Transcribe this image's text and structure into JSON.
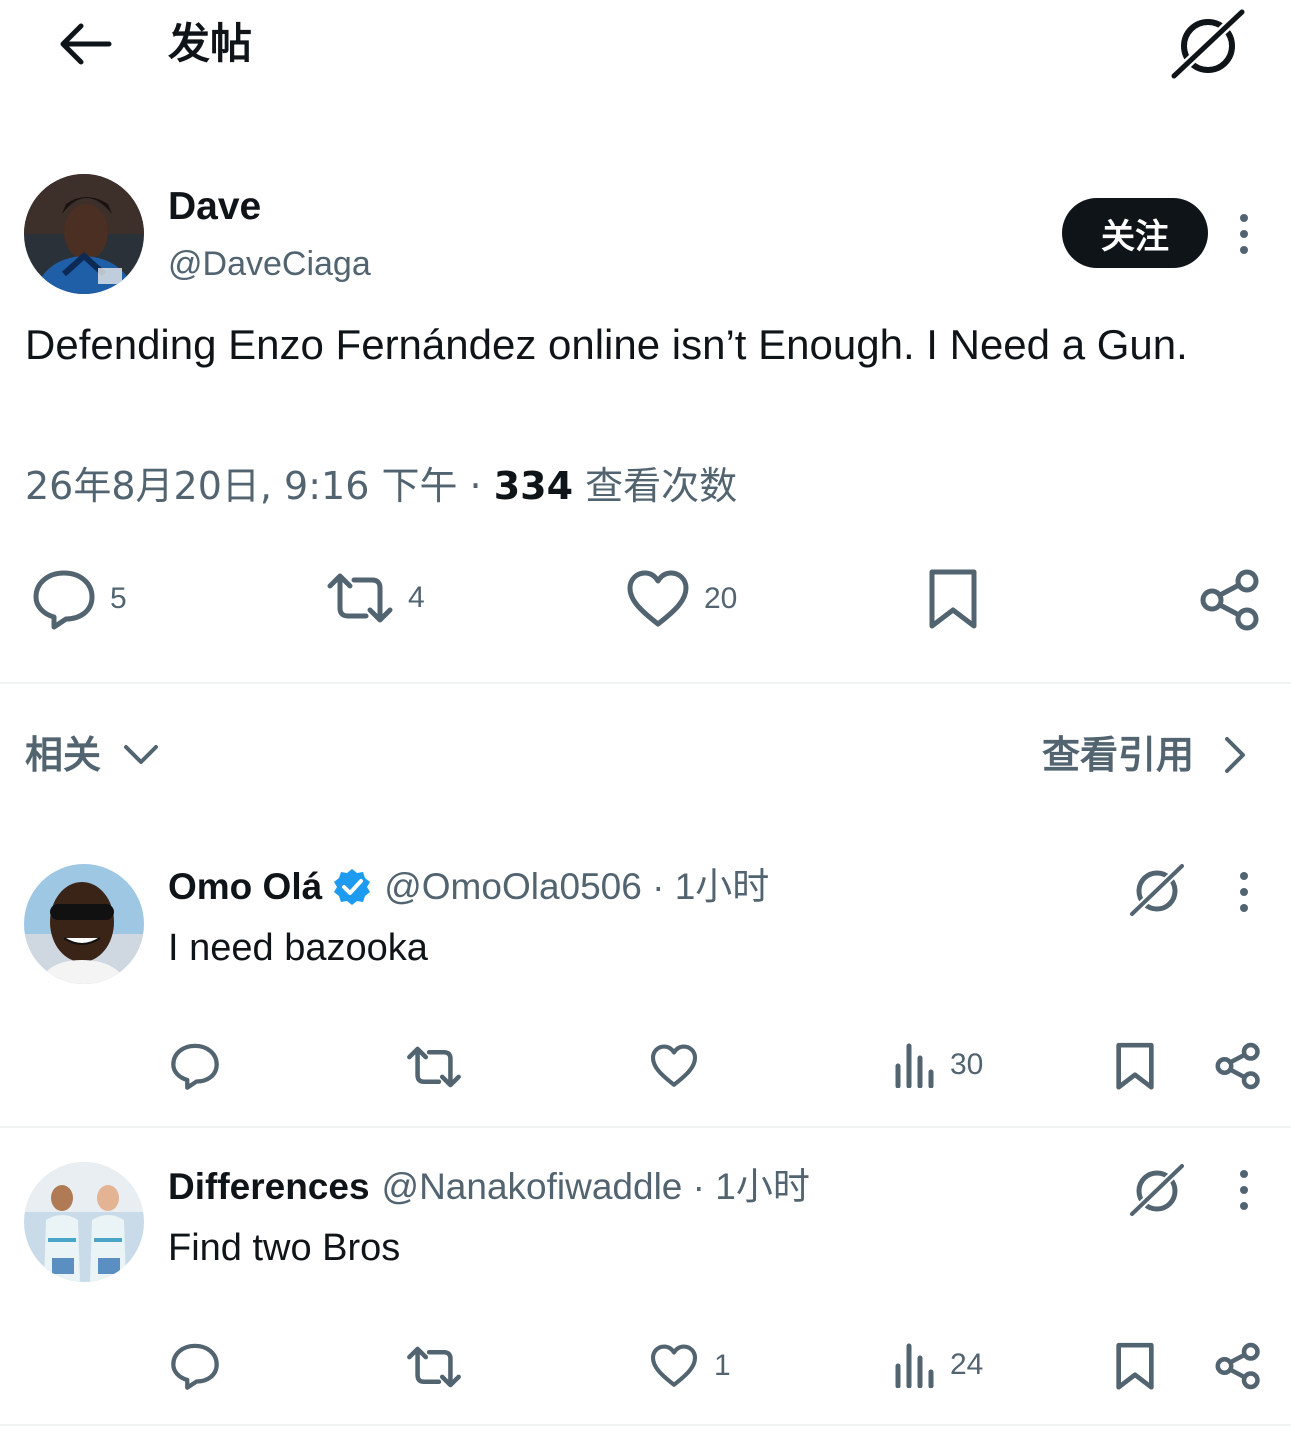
{
  "header": {
    "title": "发帖"
  },
  "post": {
    "author_name": "Dave",
    "author_handle": "@DaveCiaga",
    "follow_label": "关注",
    "text": "Defending Enzo Fernández online isn’t Enough. I Need a Gun.",
    "date": "26年8月20日, 9:16 下午 · ",
    "views_count": "334",
    "views_label": " 查看次数",
    "actions": {
      "replies": "5",
      "reposts": "4",
      "likes": "20"
    }
  },
  "section": {
    "related_label": "相关",
    "view_quotes_label": "查看引用"
  },
  "replies": [
    {
      "name": "Omo Olá",
      "verified": true,
      "handle": "@OmoOla0506 · 1小时",
      "text": "I need bazooka",
      "replies": "",
      "reposts": "",
      "likes": "",
      "views": "30"
    },
    {
      "name": "Differences",
      "verified": false,
      "handle": "@Nanakofiwaddle · 1小时",
      "text": "Find two Bros",
      "replies": "",
      "reposts": "",
      "likes": "1",
      "views": "24"
    }
  ],
  "icons": {
    "back": "arrow-left-icon",
    "grok": "grok-icon",
    "more": "more-vertical-icon",
    "reply": "reply-icon",
    "repost": "repost-icon",
    "like": "heart-icon",
    "bookmark": "bookmark-icon",
    "share": "share-icon",
    "views": "views-chart-icon",
    "verified": "verified-badge-icon"
  },
  "colors": {
    "text": "#0f1419",
    "secondary": "#536471",
    "verified": "#1d9bf0",
    "divider": "#eff3f4"
  }
}
